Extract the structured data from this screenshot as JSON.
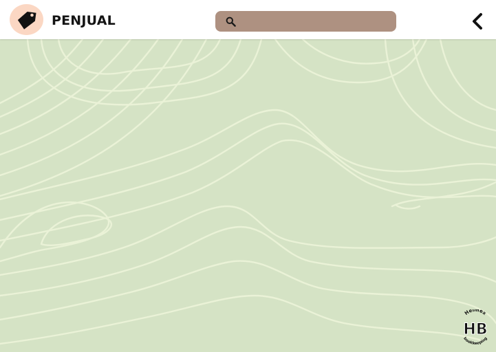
{
  "header": {
    "brand": {
      "icon": "price-tag-icon",
      "title": "PENJUAL"
    },
    "search": {
      "icon": "search-icon",
      "value": "",
      "placeholder": ""
    },
    "back_icon": "chevron-left-icon"
  },
  "colors": {
    "page_background": "#d5e3c5",
    "topo_lines": "#ecf3d8",
    "header_background": "#ffffff",
    "brand_avatar": "#fbd7c3",
    "search_background": "#ae9181"
  },
  "watermark_logo": {
    "top_text": "Helmex",
    "mark": "HB",
    "bottom_text": "bookkeeping"
  }
}
